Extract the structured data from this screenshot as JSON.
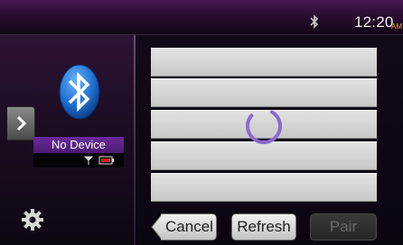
{
  "status_bar": {
    "bluetooth_icon": "bluetooth-icon",
    "time": "12:20",
    "ampm": "AM"
  },
  "left_panel": {
    "device_name": "No Device",
    "expand_icon": "chevron-right-icon",
    "settings_icon": "gear-icon",
    "signal_icon": "signal-antenna-icon",
    "battery_icon": "battery-empty-icon"
  },
  "device_list": {
    "rows": [
      "",
      "",
      "",
      "",
      ""
    ],
    "loading": true
  },
  "buttons": {
    "cancel_label": "Cancel",
    "refresh_label": "Refresh",
    "pair_label": "Pair"
  },
  "colors": {
    "accent_purple": "#6b2a9a",
    "bluetooth_blue": "#1e6fd0",
    "spinner": "#8a6ad0",
    "ampm": "#f0a030"
  }
}
